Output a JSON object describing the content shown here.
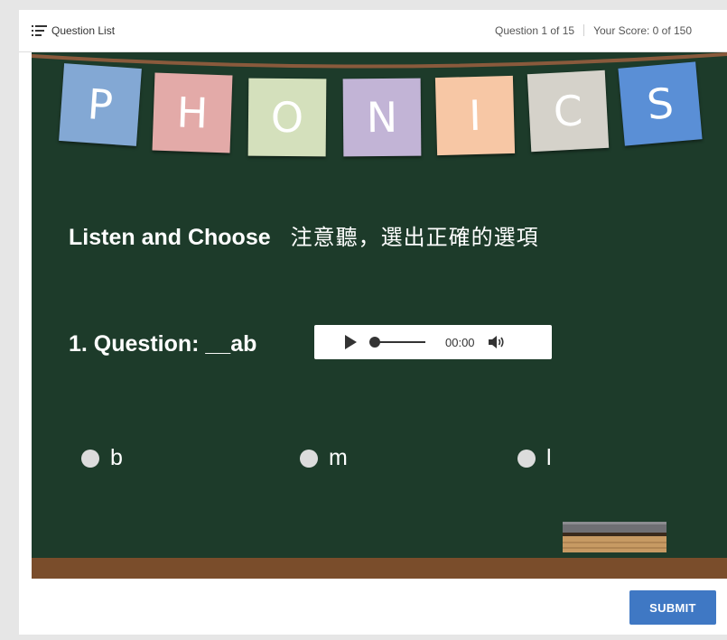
{
  "topbar": {
    "question_list_label": "Question List",
    "question_progress": "Question 1 of 15",
    "score": "Your Score: 0 of 150"
  },
  "banner": {
    "letters": [
      "P",
      "H",
      "O",
      "N",
      "I",
      "C",
      "S"
    ],
    "colors": [
      "#83a8d4",
      "#e3aaa8",
      "#d4e0bc",
      "#c2b4d6",
      "#f7c7a5",
      "#d5d2ca",
      "#5a8fd6"
    ]
  },
  "instruction": {
    "english": "Listen and Choose",
    "chinese": "注意聽，選出正確的選項"
  },
  "question": {
    "label": "1. Question: __ab",
    "audio_time": "00:00"
  },
  "options": [
    "b",
    "m",
    "l"
  ],
  "submit_label": "SUBMIT",
  "icons": {
    "list": "list-icon",
    "play": "play-icon",
    "volume": "volume-icon"
  }
}
